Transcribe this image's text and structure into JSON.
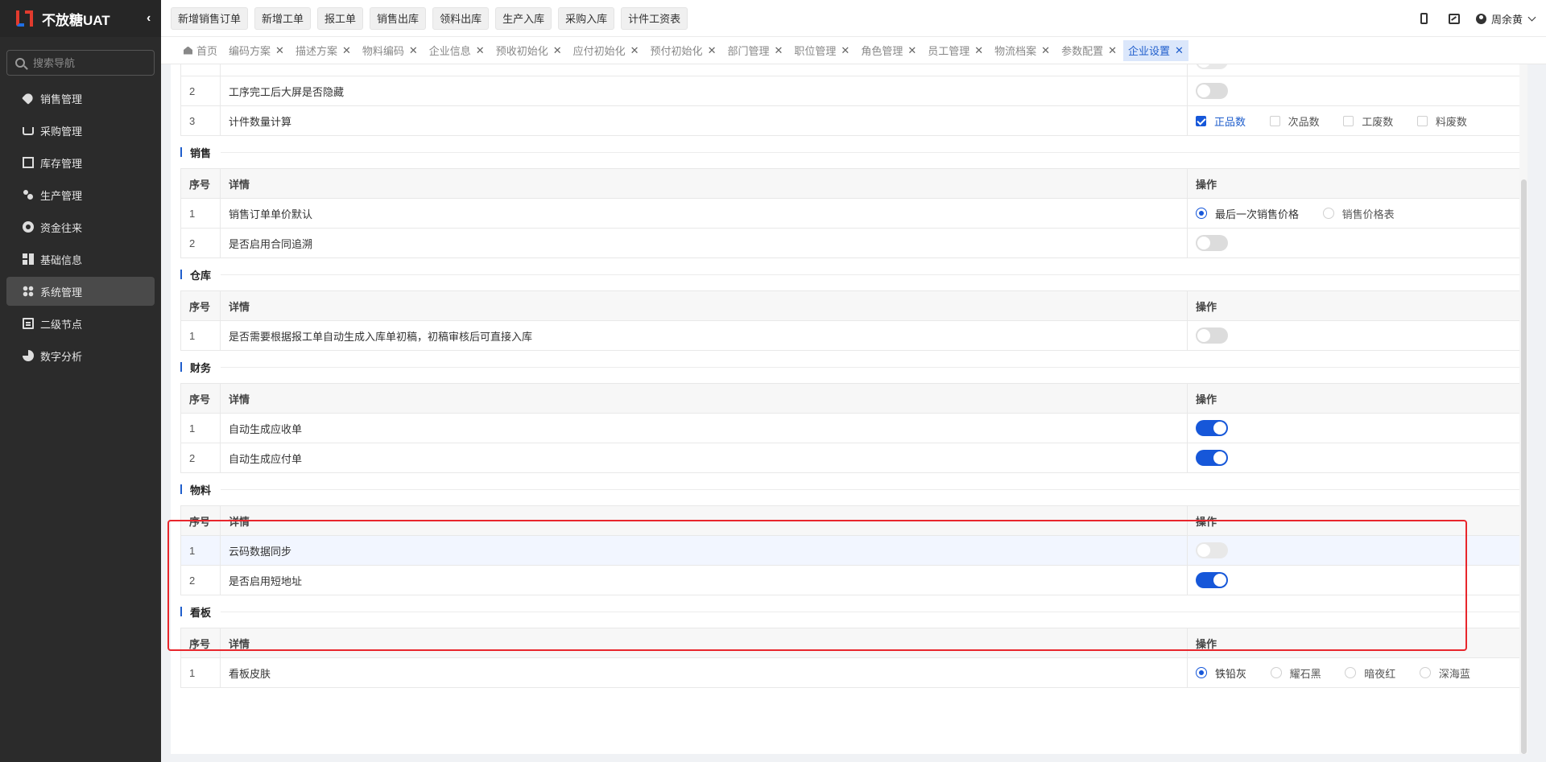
{
  "app": {
    "title": "不放糖UAT"
  },
  "sidebar": {
    "search_placeholder": "搜索导航",
    "items": [
      {
        "label": "销售管理",
        "icon": "tag-icon"
      },
      {
        "label": "采购管理",
        "icon": "cart-icon"
      },
      {
        "label": "库存管理",
        "icon": "box-icon"
      },
      {
        "label": "生产管理",
        "icon": "node-icon"
      },
      {
        "label": "资金往来",
        "icon": "coin-icon"
      },
      {
        "label": "基础信息",
        "icon": "grid-icon"
      },
      {
        "label": "系统管理",
        "icon": "apps-icon",
        "active": true
      },
      {
        "label": "二级节点",
        "icon": "doc-icon"
      },
      {
        "label": "数字分析",
        "icon": "pie-icon"
      }
    ]
  },
  "toolbar": {
    "quick_buttons": [
      "新增销售订单",
      "新增工单",
      "报工单",
      "销售出库",
      "领料出库",
      "生产入库",
      "采购入库",
      "计件工资表"
    ],
    "user_name": "周余黄"
  },
  "tabs": [
    {
      "label": "首页",
      "closable": false
    },
    {
      "label": "编码方案"
    },
    {
      "label": "描述方案"
    },
    {
      "label": "物料编码"
    },
    {
      "label": "企业信息"
    },
    {
      "label": "预收初始化"
    },
    {
      "label": "应付初始化"
    },
    {
      "label": "预付初始化"
    },
    {
      "label": "部门管理"
    },
    {
      "label": "职位管理"
    },
    {
      "label": "角色管理"
    },
    {
      "label": "员工管理"
    },
    {
      "label": "物流档案"
    },
    {
      "label": "参数配置"
    },
    {
      "label": "企业设置",
      "active": true
    }
  ],
  "table_headers": {
    "index": "序号",
    "detail": "详情",
    "action": "操作"
  },
  "sections": {
    "production": {
      "rows": [
        {
          "index": "2",
          "detail": "工序完工后大屏是否隐藏"
        },
        {
          "index": "3",
          "detail": "计件数量计算",
          "options": [
            "正品数",
            "次品数",
            "工废数",
            "料废数"
          ]
        }
      ]
    },
    "sales": {
      "title": "销售",
      "rows": [
        {
          "index": "1",
          "detail": "销售订单单价默认",
          "options": [
            "最后一次销售价格",
            "销售价格表"
          ]
        },
        {
          "index": "2",
          "detail": "是否启用合同追溯"
        }
      ]
    },
    "warehouse": {
      "title": "仓库",
      "rows": [
        {
          "index": "1",
          "detail": "是否需要根据报工单自动生成入库单初稿，初稿审核后可直接入库"
        }
      ]
    },
    "finance": {
      "title": "财务",
      "rows": [
        {
          "index": "1",
          "detail": "自动生成应收单"
        },
        {
          "index": "2",
          "detail": "自动生成应付单"
        }
      ]
    },
    "material": {
      "title": "物料",
      "rows": [
        {
          "index": "1",
          "detail": "云码数据同步"
        },
        {
          "index": "2",
          "detail": "是否启用短地址"
        }
      ]
    },
    "board": {
      "title": "看板",
      "rows": [
        {
          "index": "1",
          "detail": "看板皮肤",
          "options": [
            "铁铅灰",
            "耀石黑",
            "暗夜红",
            "深海蓝"
          ]
        }
      ]
    }
  },
  "colors": {
    "accent": "#1657d9",
    "highlight": "#e8262c"
  }
}
